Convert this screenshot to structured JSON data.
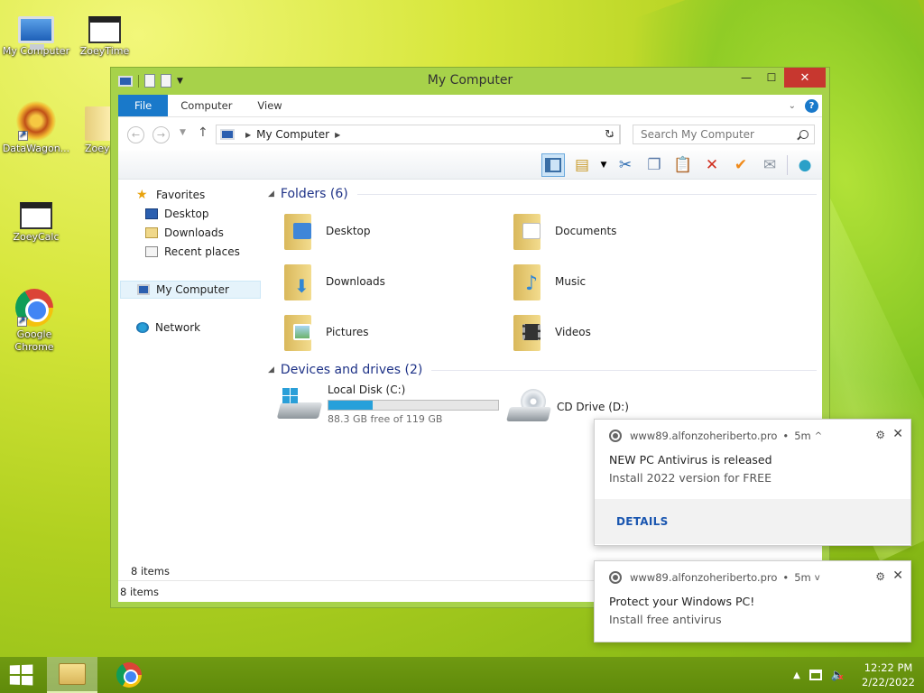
{
  "desktop": {
    "icons": [
      {
        "label": "My Computer"
      },
      {
        "label": "ZoeyTime"
      },
      {
        "label": "DataWagon..."
      },
      {
        "label": "Zoey"
      },
      {
        "label": "ZoeyCalc"
      },
      {
        "label": "Google Chrome"
      }
    ]
  },
  "window": {
    "title": "My Computer",
    "controls": {
      "minimize": "—",
      "maximize": "☐",
      "close": "✕"
    },
    "ribbon_tabs": [
      "File",
      "Computer",
      "View"
    ],
    "help": "?",
    "address": {
      "location": "My Computer"
    },
    "search": {
      "placeholder": "Search My Computer"
    },
    "nav": [
      {
        "label": "Favorites"
      },
      {
        "label": "Desktop"
      },
      {
        "label": "Downloads"
      },
      {
        "label": "Recent places"
      },
      {
        "label": "My Computer"
      },
      {
        "label": "Network"
      }
    ],
    "folders_header": "Folders (6)",
    "folders": [
      {
        "name": "Desktop"
      },
      {
        "name": "Documents"
      },
      {
        "name": "Downloads"
      },
      {
        "name": "Music"
      },
      {
        "name": "Pictures"
      },
      {
        "name": "Videos"
      }
    ],
    "devices_header": "Devices and drives (2)",
    "drives": [
      {
        "name": "Local Disk (C:)",
        "free": "88.3 GB free of 119 GB",
        "used_fraction": 0.258
      },
      {
        "name": "CD Drive (D:)"
      }
    ],
    "item_count": "8 items",
    "status": "8 items"
  },
  "notifications": [
    {
      "source": "www89.alfonzoheriberto.pro",
      "age": "5m",
      "expand": "^",
      "title": "NEW PC Antivirus is released",
      "body": "Install 2022 version for FREE",
      "action": "DETAILS"
    },
    {
      "source": "www89.alfonzoheriberto.pro",
      "age": "5m",
      "expand": "v",
      "title": "Protect your Windows PC!",
      "body": "Install free antivirus"
    }
  ],
  "taskbar": {
    "time": "12:22 PM",
    "date": "2/22/2022"
  },
  "colors": {
    "accent": "#1979ca",
    "window_frame": "#a7d24a",
    "taskbar": "#6f9a12",
    "close_button": "#c7372f",
    "drive_bar": "#26a0da"
  }
}
